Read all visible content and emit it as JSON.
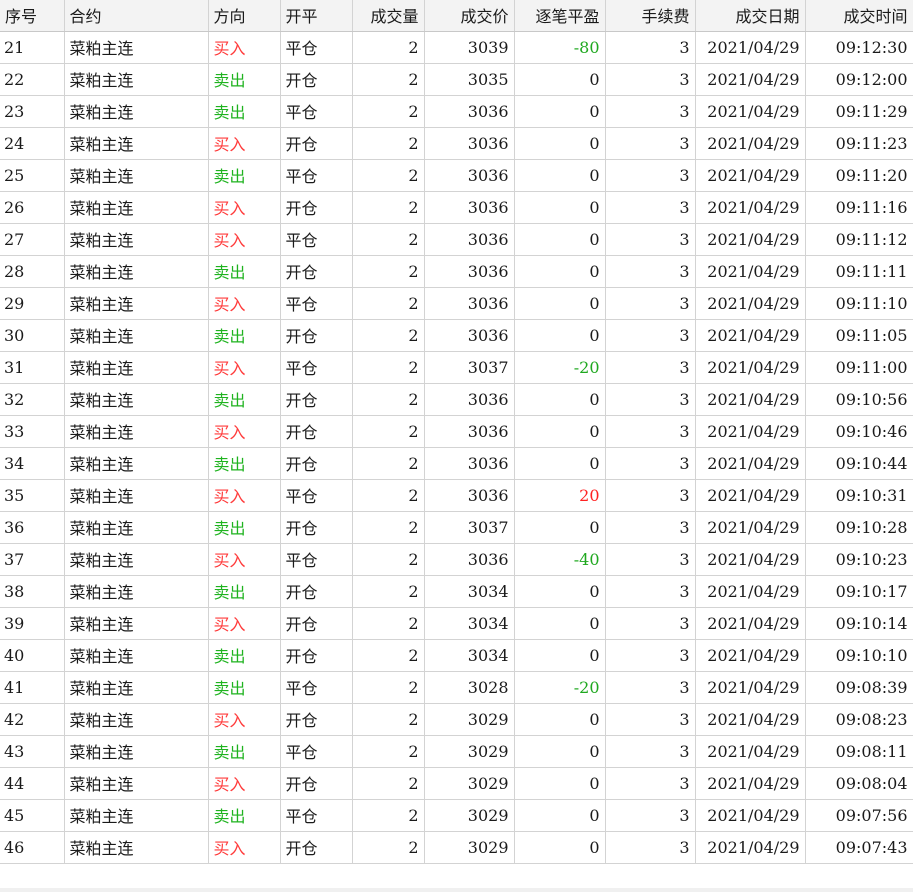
{
  "table": {
    "headers": [
      "序号",
      "合约",
      "方向",
      "开平",
      "成交量",
      "成交价",
      "逐笔平盈",
      "手续费",
      "成交日期",
      "成交时间"
    ],
    "rows": [
      {
        "id": "21",
        "contract": "菜粕主连",
        "direction": "买入",
        "openclose": "平仓",
        "volume": "2",
        "price": "3039",
        "pnl": "-80",
        "fee": "3",
        "date": "2021/04/29",
        "time": "09:12:30"
      },
      {
        "id": "22",
        "contract": "菜粕主连",
        "direction": "卖出",
        "openclose": "开仓",
        "volume": "2",
        "price": "3035",
        "pnl": "0",
        "fee": "3",
        "date": "2021/04/29",
        "time": "09:12:00"
      },
      {
        "id": "23",
        "contract": "菜粕主连",
        "direction": "卖出",
        "openclose": "平仓",
        "volume": "2",
        "price": "3036",
        "pnl": "0",
        "fee": "3",
        "date": "2021/04/29",
        "time": "09:11:29"
      },
      {
        "id": "24",
        "contract": "菜粕主连",
        "direction": "买入",
        "openclose": "开仓",
        "volume": "2",
        "price": "3036",
        "pnl": "0",
        "fee": "3",
        "date": "2021/04/29",
        "time": "09:11:23"
      },
      {
        "id": "25",
        "contract": "菜粕主连",
        "direction": "卖出",
        "openclose": "平仓",
        "volume": "2",
        "price": "3036",
        "pnl": "0",
        "fee": "3",
        "date": "2021/04/29",
        "time": "09:11:20"
      },
      {
        "id": "26",
        "contract": "菜粕主连",
        "direction": "买入",
        "openclose": "开仓",
        "volume": "2",
        "price": "3036",
        "pnl": "0",
        "fee": "3",
        "date": "2021/04/29",
        "time": "09:11:16"
      },
      {
        "id": "27",
        "contract": "菜粕主连",
        "direction": "买入",
        "openclose": "平仓",
        "volume": "2",
        "price": "3036",
        "pnl": "0",
        "fee": "3",
        "date": "2021/04/29",
        "time": "09:11:12"
      },
      {
        "id": "28",
        "contract": "菜粕主连",
        "direction": "卖出",
        "openclose": "开仓",
        "volume": "2",
        "price": "3036",
        "pnl": "0",
        "fee": "3",
        "date": "2021/04/29",
        "time": "09:11:11"
      },
      {
        "id": "29",
        "contract": "菜粕主连",
        "direction": "买入",
        "openclose": "平仓",
        "volume": "2",
        "price": "3036",
        "pnl": "0",
        "fee": "3",
        "date": "2021/04/29",
        "time": "09:11:10"
      },
      {
        "id": "30",
        "contract": "菜粕主连",
        "direction": "卖出",
        "openclose": "开仓",
        "volume": "2",
        "price": "3036",
        "pnl": "0",
        "fee": "3",
        "date": "2021/04/29",
        "time": "09:11:05"
      },
      {
        "id": "31",
        "contract": "菜粕主连",
        "direction": "买入",
        "openclose": "平仓",
        "volume": "2",
        "price": "3037",
        "pnl": "-20",
        "fee": "3",
        "date": "2021/04/29",
        "time": "09:11:00"
      },
      {
        "id": "32",
        "contract": "菜粕主连",
        "direction": "卖出",
        "openclose": "开仓",
        "volume": "2",
        "price": "3036",
        "pnl": "0",
        "fee": "3",
        "date": "2021/04/29",
        "time": "09:10:56"
      },
      {
        "id": "33",
        "contract": "菜粕主连",
        "direction": "买入",
        "openclose": "开仓",
        "volume": "2",
        "price": "3036",
        "pnl": "0",
        "fee": "3",
        "date": "2021/04/29",
        "time": "09:10:46"
      },
      {
        "id": "34",
        "contract": "菜粕主连",
        "direction": "卖出",
        "openclose": "开仓",
        "volume": "2",
        "price": "3036",
        "pnl": "0",
        "fee": "3",
        "date": "2021/04/29",
        "time": "09:10:44"
      },
      {
        "id": "35",
        "contract": "菜粕主连",
        "direction": "买入",
        "openclose": "平仓",
        "volume": "2",
        "price": "3036",
        "pnl": "20",
        "fee": "3",
        "date": "2021/04/29",
        "time": "09:10:31"
      },
      {
        "id": "36",
        "contract": "菜粕主连",
        "direction": "卖出",
        "openclose": "开仓",
        "volume": "2",
        "price": "3037",
        "pnl": "0",
        "fee": "3",
        "date": "2021/04/29",
        "time": "09:10:28"
      },
      {
        "id": "37",
        "contract": "菜粕主连",
        "direction": "买入",
        "openclose": "平仓",
        "volume": "2",
        "price": "3036",
        "pnl": "-40",
        "fee": "3",
        "date": "2021/04/29",
        "time": "09:10:23"
      },
      {
        "id": "38",
        "contract": "菜粕主连",
        "direction": "卖出",
        "openclose": "开仓",
        "volume": "2",
        "price": "3034",
        "pnl": "0",
        "fee": "3",
        "date": "2021/04/29",
        "time": "09:10:17"
      },
      {
        "id": "39",
        "contract": "菜粕主连",
        "direction": "买入",
        "openclose": "开仓",
        "volume": "2",
        "price": "3034",
        "pnl": "0",
        "fee": "3",
        "date": "2021/04/29",
        "time": "09:10:14"
      },
      {
        "id": "40",
        "contract": "菜粕主连",
        "direction": "卖出",
        "openclose": "开仓",
        "volume": "2",
        "price": "3034",
        "pnl": "0",
        "fee": "3",
        "date": "2021/04/29",
        "time": "09:10:10"
      },
      {
        "id": "41",
        "contract": "菜粕主连",
        "direction": "卖出",
        "openclose": "平仓",
        "volume": "2",
        "price": "3028",
        "pnl": "-20",
        "fee": "3",
        "date": "2021/04/29",
        "time": "09:08:39"
      },
      {
        "id": "42",
        "contract": "菜粕主连",
        "direction": "买入",
        "openclose": "开仓",
        "volume": "2",
        "price": "3029",
        "pnl": "0",
        "fee": "3",
        "date": "2021/04/29",
        "time": "09:08:23"
      },
      {
        "id": "43",
        "contract": "菜粕主连",
        "direction": "卖出",
        "openclose": "平仓",
        "volume": "2",
        "price": "3029",
        "pnl": "0",
        "fee": "3",
        "date": "2021/04/29",
        "time": "09:08:11"
      },
      {
        "id": "44",
        "contract": "菜粕主连",
        "direction": "买入",
        "openclose": "开仓",
        "volume": "2",
        "price": "3029",
        "pnl": "0",
        "fee": "3",
        "date": "2021/04/29",
        "time": "09:08:04"
      },
      {
        "id": "45",
        "contract": "菜粕主连",
        "direction": "卖出",
        "openclose": "平仓",
        "volume": "2",
        "price": "3029",
        "pnl": "0",
        "fee": "3",
        "date": "2021/04/29",
        "time": "09:07:56"
      },
      {
        "id": "46",
        "contract": "菜粕主连",
        "direction": "买入",
        "openclose": "开仓",
        "volume": "2",
        "price": "3029",
        "pnl": "0",
        "fee": "3",
        "date": "2021/04/29",
        "time": "09:07:43"
      }
    ]
  },
  "colors": {
    "buy": "#ff3b3b",
    "sell": "#1fb31f",
    "profit": "#ff2222",
    "loss": "#1fa81f",
    "header_bg": "#f3f3f3",
    "grid_line": "#d3d3d3"
  }
}
